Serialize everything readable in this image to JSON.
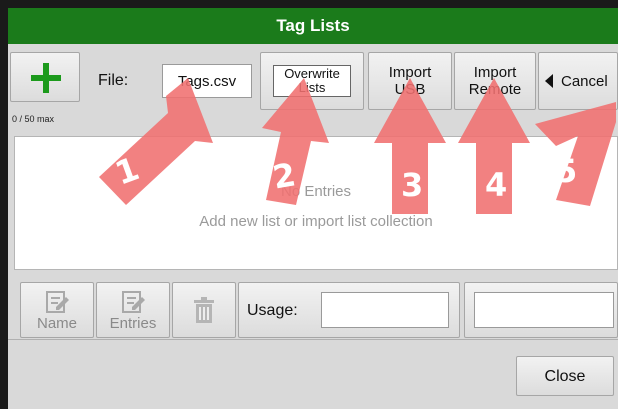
{
  "window": {
    "title": "Tag Lists"
  },
  "toolbar": {
    "file_label": "File:",
    "file_value": "Tags.csv",
    "count_text": "0 / 50 max",
    "overwrite_label": "Overwrite Lists",
    "import_usb_label": "Import USB",
    "import_remote_label": "Import Remote",
    "cancel_label": "Cancel"
  },
  "list": {
    "empty_title": "No Entries",
    "empty_hint": "Add new list or import list collection"
  },
  "actions": {
    "name_label": "Name",
    "entries_label": "Entries",
    "usage_label": "Usage:",
    "usage_value_1": "",
    "usage_value_2": ""
  },
  "footer": {
    "close_label": "Close"
  },
  "annotations": [
    "1",
    "2",
    "3",
    "4",
    "5"
  ],
  "colors": {
    "titlebar": "#1b7b1b",
    "plus": "#1c9a1c",
    "arrow": "#f07070"
  },
  "icons": {
    "add": "plus-icon",
    "edit": "edit-icon",
    "delete": "trash-icon",
    "back": "triangle-left-icon"
  }
}
